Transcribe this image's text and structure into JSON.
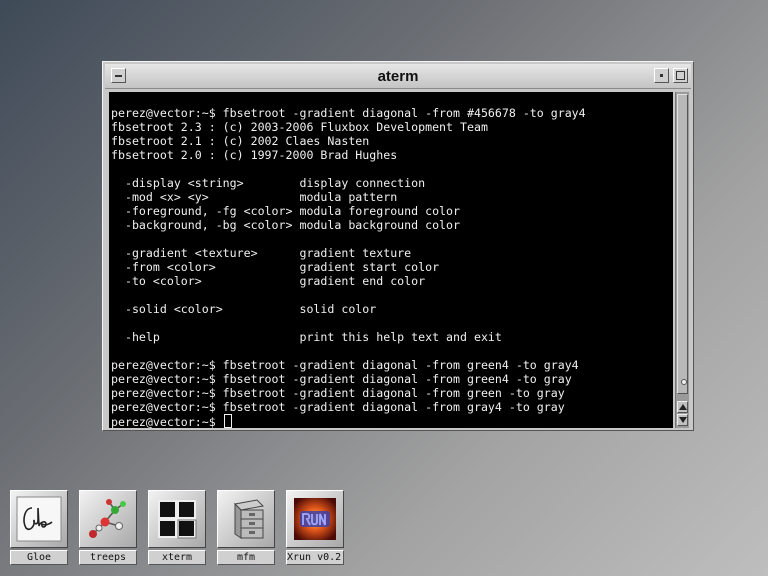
{
  "window": {
    "title": "aterm"
  },
  "terminal": {
    "lines": [
      "perez@vector:~$ fbsetroot -gradient diagonal -from #456678 -to gray4",
      "fbsetroot 2.3 : (c) 2003-2006 Fluxbox Development Team",
      "fbsetroot 2.1 : (c) 2002 Claes Nasten",
      "fbsetroot 2.0 : (c) 1997-2000 Brad Hughes",
      "",
      "  -display <string>        display connection",
      "  -mod <x> <y>             modula pattern",
      "  -foreground, -fg <color> modula foreground color",
      "  -background, -bg <color> modula background color",
      "",
      "  -gradient <texture>      gradient texture",
      "  -from <color>            gradient start color",
      "  -to <color>              gradient end color",
      "",
      "  -solid <color>           solid color",
      "",
      "  -help                    print this help text and exit",
      "",
      "perez@vector:~$ fbsetroot -gradient diagonal -from green4 -to gray4",
      "perez@vector:~$ fbsetroot -gradient diagonal -from green4 -to gray",
      "perez@vector:~$ fbsetroot -gradient diagonal -from green -to gray",
      "perez@vector:~$ fbsetroot -gradient diagonal -from gray4 -to gray"
    ],
    "prompt": "perez@vector:~$ "
  },
  "dock": [
    {
      "label": "Gloe",
      "icon": "gloe-signature-icon"
    },
    {
      "label": "treeps",
      "icon": "molecule-tree-icon"
    },
    {
      "label": "xterm",
      "icon": "xterm-windows-icon"
    },
    {
      "label": "mfm",
      "icon": "file-cabinet-icon"
    },
    {
      "label": "Xrun v0.2.",
      "icon": "xrun-logo-icon"
    }
  ],
  "colors": {
    "terminal_bg": "#000000",
    "terminal_fg": "#f0f0f0",
    "chrome": "#c8c8c8"
  }
}
